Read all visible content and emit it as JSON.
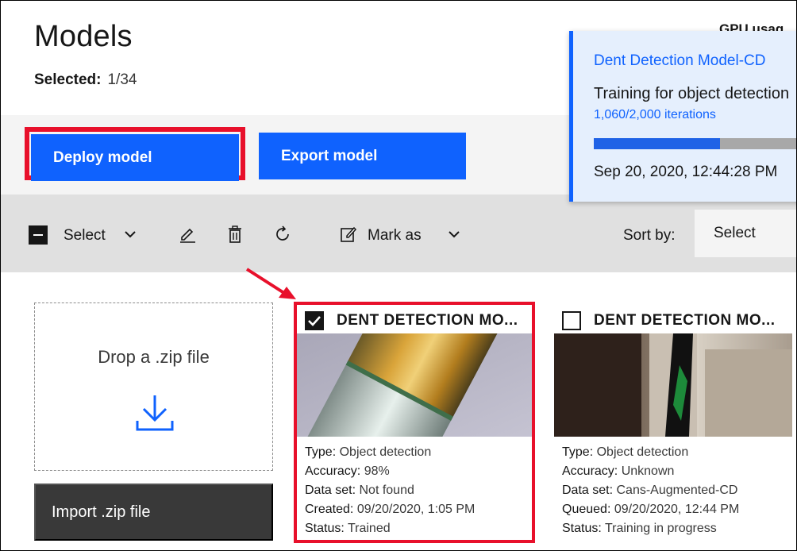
{
  "header": {
    "title": "Models",
    "selected_label": "Selected:",
    "selected_value": "1/34",
    "gpu_label": "GPU usag"
  },
  "actions": {
    "deploy_label": "Deploy model",
    "export_label": "Export model"
  },
  "toast": {
    "title": "Dent Detection Model-CD",
    "description": "Training for object detection",
    "iterations": "1,060/2,000 iterations",
    "progress": 0.53,
    "timestamp": "Sep 20, 2020, 12:44:28 PM"
  },
  "toolbar": {
    "select_label": "Select",
    "mark_as_label": "Mark as",
    "sort_by_label": "Sort by:",
    "sort_value": "Select",
    "icons": [
      "edit-icon",
      "trash-icon",
      "refresh-icon",
      "mark-edit-icon"
    ]
  },
  "dropzone": {
    "text": "Drop a .zip file",
    "import_label": "Import .zip file"
  },
  "cards": [
    {
      "title": "DENT DETECTION MO...",
      "checked": true,
      "fields": [
        {
          "key": "Type:",
          "value": "Object detection"
        },
        {
          "key": "Accuracy:",
          "value": "98%"
        },
        {
          "key": "Data set:",
          "value": "Not found"
        },
        {
          "key": "Created:",
          "value": "09/20/2020, 1:05 PM"
        },
        {
          "key": "Status:",
          "value": "Trained"
        }
      ]
    },
    {
      "title": "DENT DETECTION MO...",
      "checked": false,
      "fields": [
        {
          "key": "Type:",
          "value": "Object detection"
        },
        {
          "key": "Accuracy:",
          "value": "Unknown"
        },
        {
          "key": "Data set:",
          "value": "Cans-Augmented-CD"
        },
        {
          "key": "Queued:",
          "value": "09/20/2020, 12:44 PM"
        },
        {
          "key": "Status:",
          "value": "Training in progress"
        }
      ]
    }
  ],
  "colors": {
    "primary": "#0f62fe",
    "highlight": "#e8102b",
    "dark_button": "#393939"
  }
}
